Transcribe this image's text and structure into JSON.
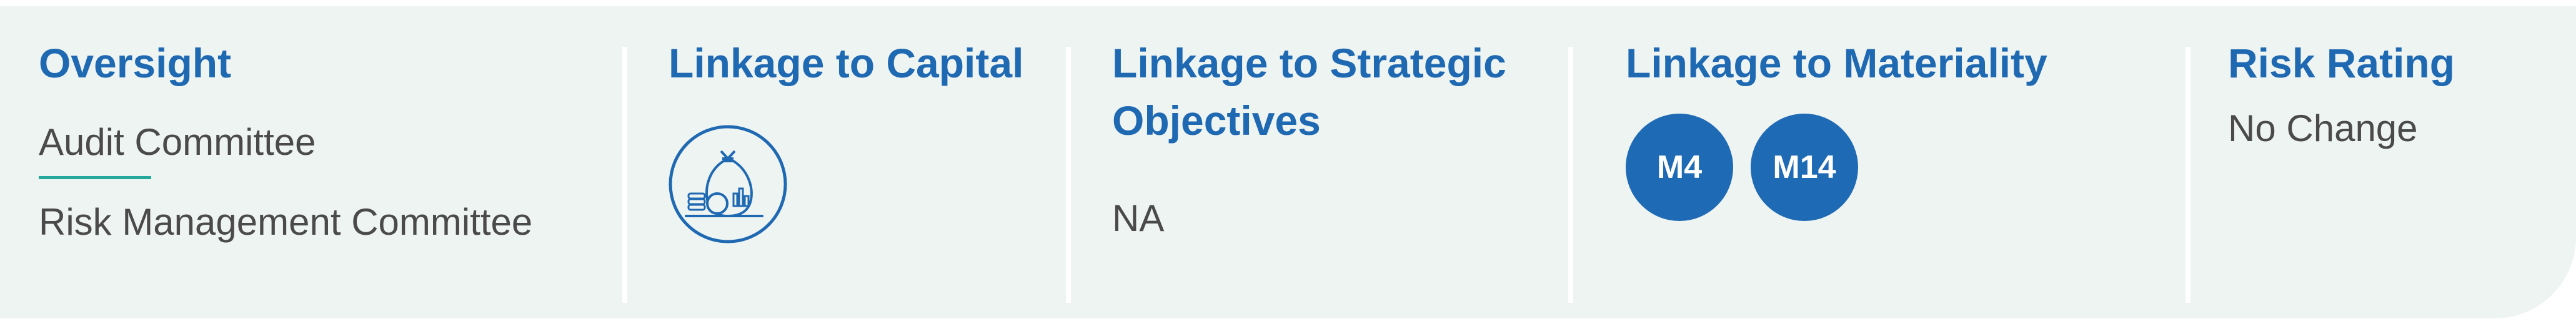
{
  "oversight": {
    "heading": "Oversight",
    "items": [
      "Audit Committee",
      "Risk Management Committee"
    ]
  },
  "capital": {
    "heading": "Linkage to Capital",
    "icon": "money-bag-icon"
  },
  "strategic": {
    "heading_line1": "Linkage to Strategic",
    "heading_line2": "Objectives",
    "value": "NA"
  },
  "materiality": {
    "heading": "Linkage to Materiality",
    "badges": [
      "M4",
      "M14"
    ]
  },
  "risk": {
    "heading": "Risk Rating",
    "value": "No Change"
  },
  "colors": {
    "heading": "#1f69b3",
    "badge": "#1e6ab5",
    "accent": "#23a99e",
    "panel_bg": "#eef4f2",
    "text": "#4a4a4a"
  }
}
